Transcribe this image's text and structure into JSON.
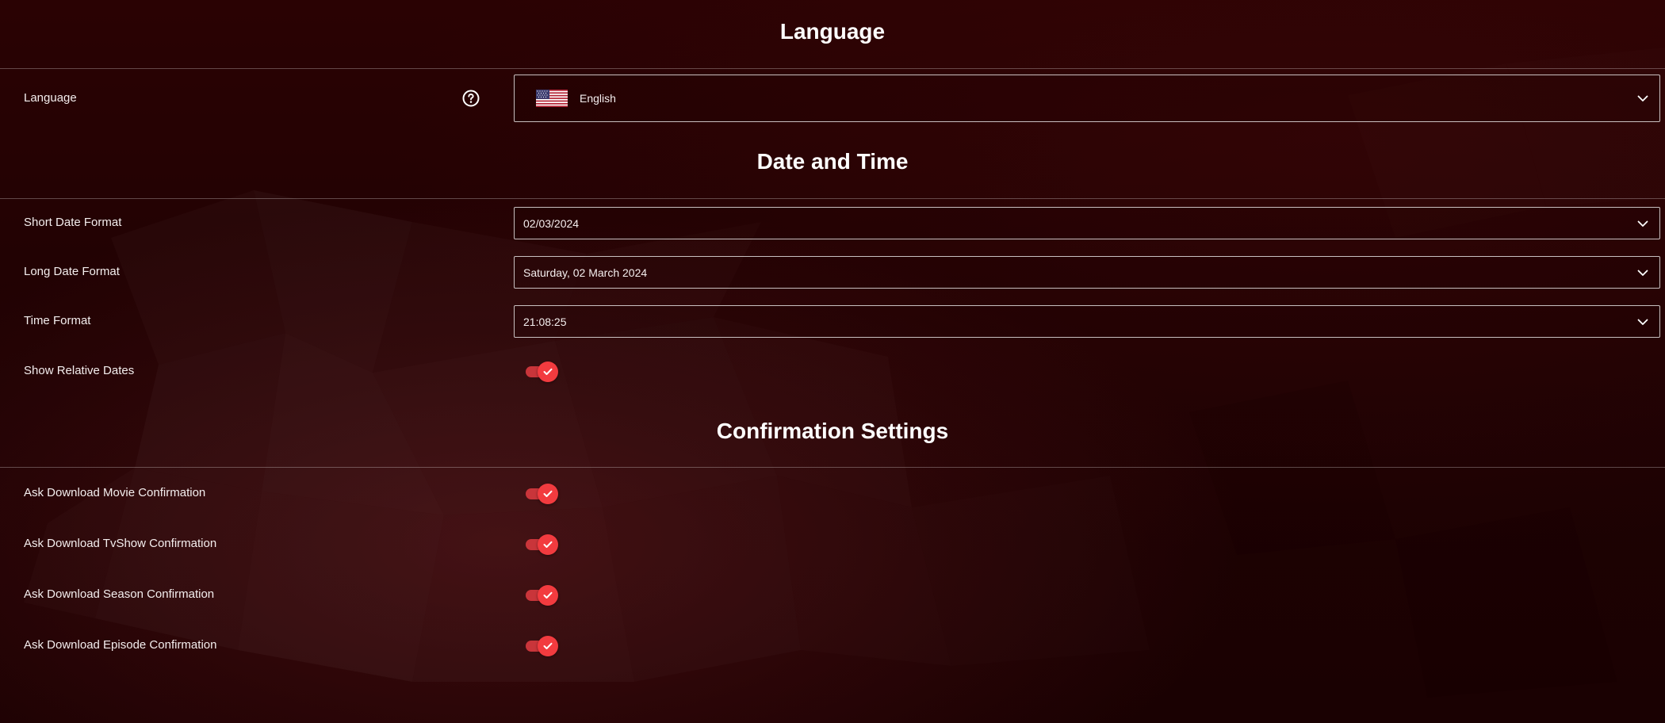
{
  "language_section": {
    "title": "Language",
    "language_label": "Language",
    "language_value": "English",
    "flag": "us-flag-icon"
  },
  "date_time_section": {
    "title": "Date and Time",
    "short_date_label": "Short Date Format",
    "short_date_value": "02/03/2024",
    "long_date_label": "Long Date Format",
    "long_date_value": "Saturday, 02 March 2024",
    "time_label": "Time Format",
    "time_value": "21:08:25",
    "relative_dates_label": "Show Relative Dates",
    "relative_dates_enabled": true
  },
  "confirmation_section": {
    "title": "Confirmation Settings",
    "items": [
      {
        "label": "Ask Download Movie Confirmation",
        "enabled": true
      },
      {
        "label": "Ask Download TvShow Confirmation",
        "enabled": true
      },
      {
        "label": "Ask Download Season Confirmation",
        "enabled": true
      },
      {
        "label": "Ask Download Episode Confirmation",
        "enabled": true
      }
    ]
  },
  "colors": {
    "background": "#220203",
    "toggle_on": "#f23b3f",
    "toggle_track": "#c9353a",
    "text": "#ffffff"
  },
  "icons": {
    "help": "question-circle-icon",
    "dropdown": "chevron-down-icon",
    "toggle_check": "check-icon"
  }
}
